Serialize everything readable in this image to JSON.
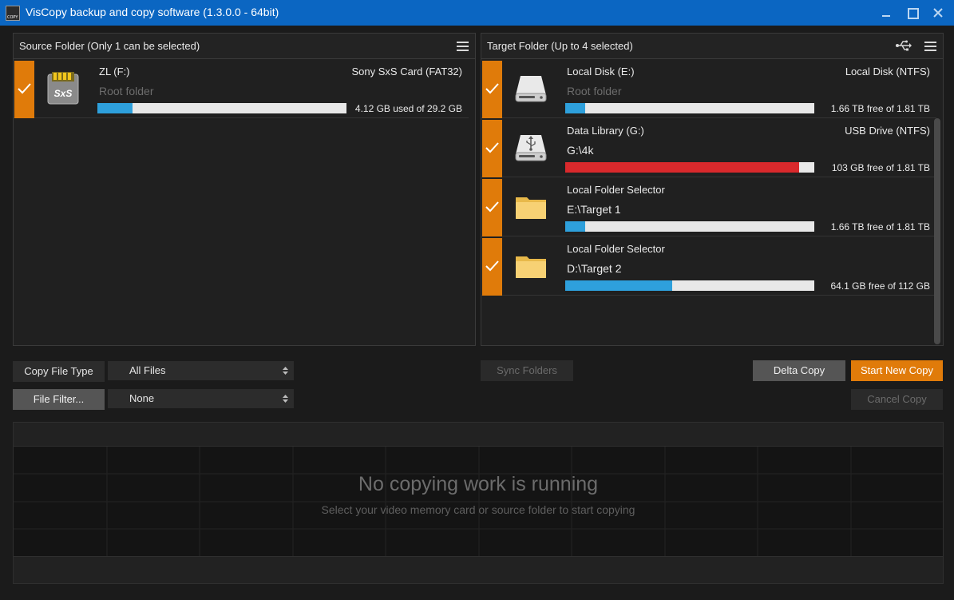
{
  "window": {
    "title": "VisCopy backup and copy software (1.3.0.0 - 64bit)",
    "app_icon": "viscopy-app-icon",
    "controls": [
      "minimize-icon",
      "maximize-icon",
      "close-icon"
    ]
  },
  "source": {
    "title": "Source Folder (Only 1 can be selected)",
    "items": [
      {
        "name": "ZL (F:)",
        "type": "Sony SxS Card (FAT32)",
        "path": "Root folder",
        "capacity": "4.12 GB used of 29.2 GB",
        "usage_fraction": 0.14,
        "bar_color": "#2ea0dc",
        "icon": "sxs-card-icon"
      }
    ]
  },
  "target": {
    "title": "Target Folder (Up to 4 selected)",
    "items": [
      {
        "name": "Local Disk (E:)",
        "type": "Local Disk (NTFS)",
        "path": "Root folder",
        "capacity": "1.66 TB free of 1.81 TB",
        "usage_fraction": 0.08,
        "bar_color": "#2ea0dc",
        "icon": "hard-disk-icon"
      },
      {
        "name": "Data Library (G:)",
        "type": "USB Drive (NTFS)",
        "path": "G:\\4k",
        "capacity": "103 GB free of 1.81 TB",
        "usage_fraction": 0.94,
        "bar_color": "#d9292c",
        "icon": "usb-drive-icon"
      },
      {
        "name": "Local Folder Selector",
        "type": "",
        "path": "E:\\Target 1",
        "capacity": "1.66 TB free of 1.81 TB",
        "usage_fraction": 0.08,
        "bar_color": "#2ea0dc",
        "icon": "folder-icon"
      },
      {
        "name": "Local Folder Selector",
        "type": "",
        "path": "D:\\Target 2",
        "capacity": "64.1 GB free of 112 GB",
        "usage_fraction": 0.43,
        "bar_color": "#2ea0dc",
        "icon": "folder-icon"
      }
    ]
  },
  "controls": {
    "copy_file_type_label": "Copy File Type",
    "copy_file_type_value": "All Files",
    "file_filter_label": "File Filter...",
    "file_filter_value": "None",
    "sync_folders": "Sync Folders",
    "delta_copy": "Delta Copy",
    "start_new_copy": "Start New Copy",
    "cancel_copy": "Cancel Copy"
  },
  "status": {
    "main": "No copying work is running",
    "sub": "Select your video memory card or source folder to start copying"
  },
  "colors": {
    "accent": "#e07b0a",
    "titlebar": "#0b66c2",
    "progress_blue": "#2ea0dc",
    "progress_red": "#d9292c"
  }
}
